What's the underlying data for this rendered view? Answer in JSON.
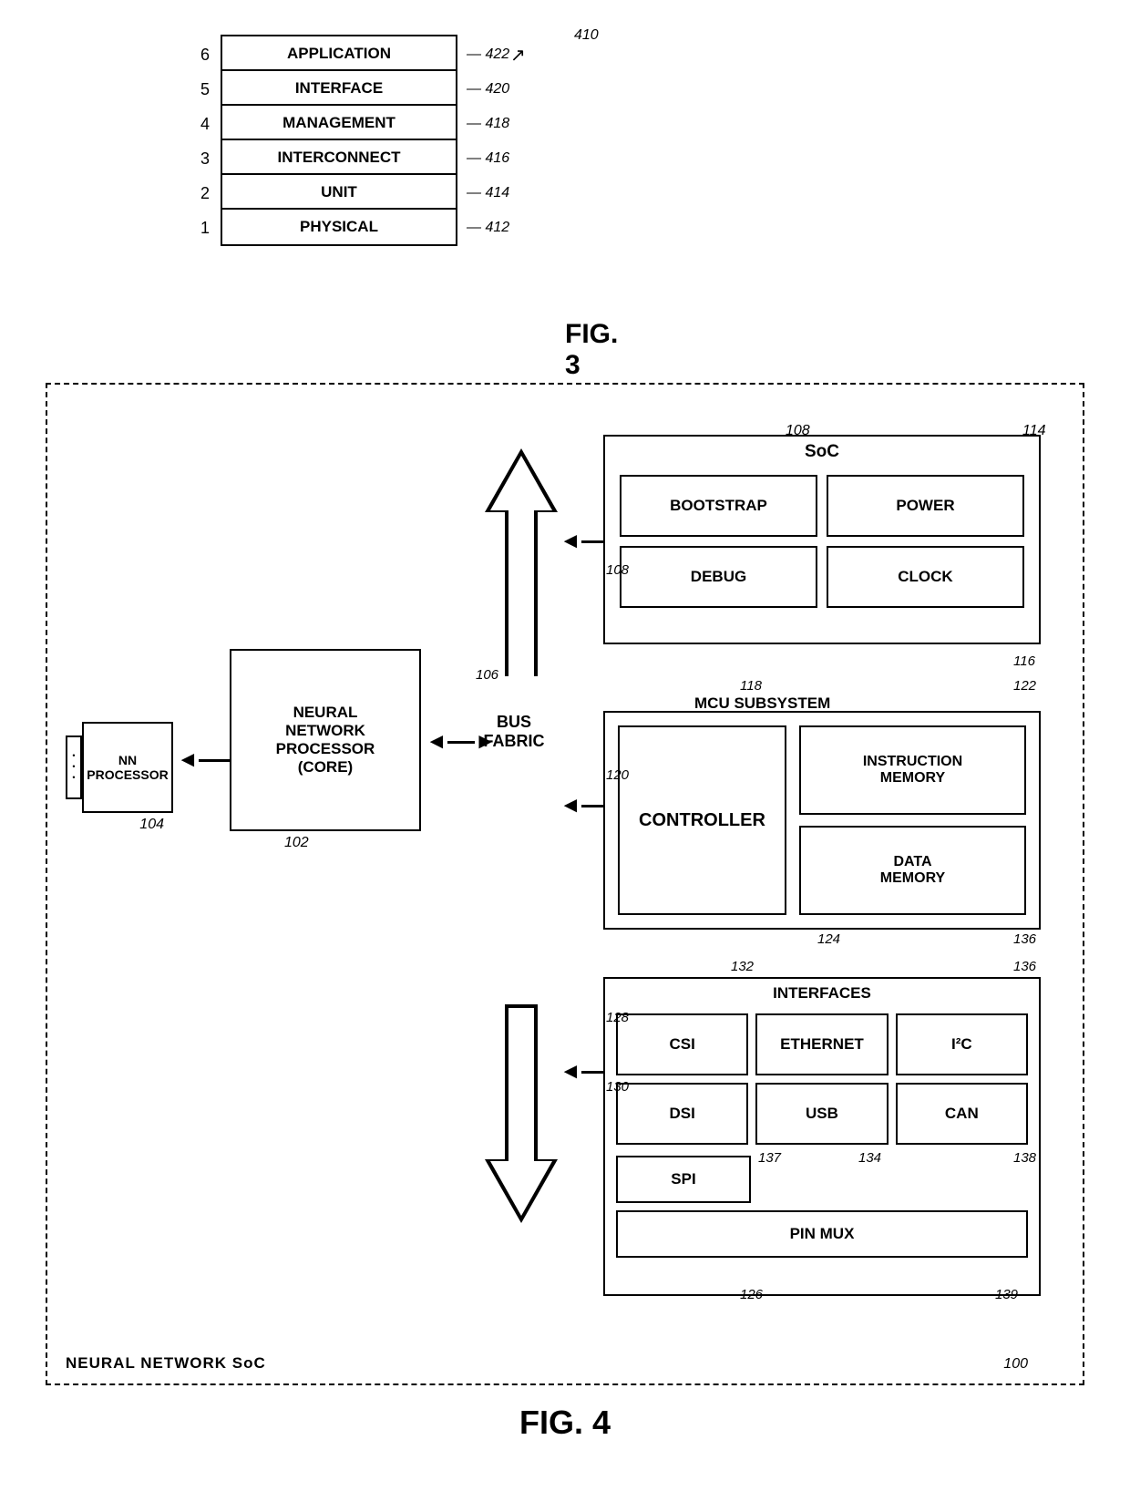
{
  "fig3": {
    "title": "FIG. 3",
    "arrow_ref": "410",
    "layers": [
      {
        "num": "6",
        "label": "APPLICATION",
        "ref": "422"
      },
      {
        "num": "5",
        "label": "INTERFACE",
        "ref": "420"
      },
      {
        "num": "4",
        "label": "MANAGEMENT",
        "ref": "418"
      },
      {
        "num": "3",
        "label": "INTERCONNECT",
        "ref": "416"
      },
      {
        "num": "2",
        "label": "UNIT",
        "ref": "414"
      },
      {
        "num": "1",
        "label": "PHYSICAL",
        "ref": "412"
      }
    ]
  },
  "fig4": {
    "title": "FIG. 4",
    "outer_label": "NEURAL NETWORK SoC",
    "outer_ref": "100",
    "nn_processor": {
      "label": "NN\nPROCESSOR",
      "ref": "104"
    },
    "nnp_core": {
      "label": "NEURAL\nNETWORK\nPROCESSOR\n(CORE)",
      "ref": "102"
    },
    "bus_fabric": {
      "label": "BUS\nFABRIC"
    },
    "bus_ref": "106",
    "soc": {
      "title": "SoC",
      "ref": "108",
      "ref2": "114",
      "items": [
        "BOOTSTRAP",
        "POWER",
        "DEBUG",
        "CLOCK"
      ],
      "item_refs": [
        "108",
        "116"
      ]
    },
    "mcu": {
      "title": "MCU  SUBSYSTEM",
      "ref": "118",
      "ref2": "122",
      "ref3": "120",
      "controller": "CONTROLLER",
      "instruction_memory": "INSTRUCTION\nMEMORY",
      "data_memory": "DATA\nMEMORY",
      "mem_refs": [
        "124",
        "136"
      ]
    },
    "interfaces": {
      "title": "INTERFACES",
      "ref": "132",
      "ref2": "136",
      "ref3": "128",
      "ref4": "130",
      "items_row1": [
        "CSI",
        "ETHERNET",
        "I²C"
      ],
      "items_row2": [
        "DSI",
        "USB",
        "CAN"
      ],
      "item_refs": [
        "128",
        "130",
        "134",
        "137",
        "138"
      ],
      "spi": "SPI",
      "spi_ref": "137",
      "pin_mux": "PIN  MUX",
      "pin_mux_ref": "126",
      "pin_mux_ref2": "139",
      "usb_ref": "134",
      "can_ref": "138"
    }
  }
}
